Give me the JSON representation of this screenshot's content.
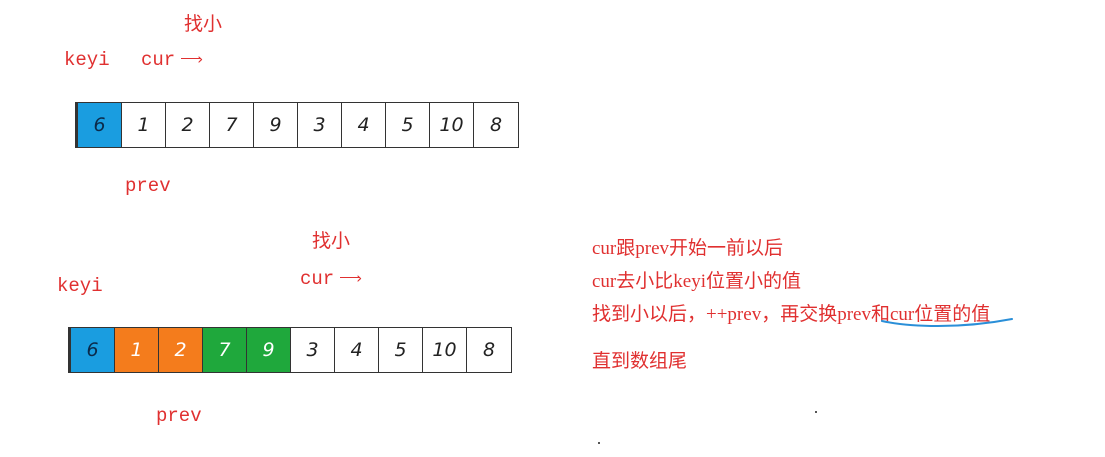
{
  "diagram1": {
    "find_small": "找小",
    "keyi": "keyi",
    "cur": "cur",
    "prev": "prev",
    "cells": [
      {
        "value": "6",
        "color": "blue"
      },
      {
        "value": "1",
        "color": "none"
      },
      {
        "value": "2",
        "color": "none"
      },
      {
        "value": "7",
        "color": "none"
      },
      {
        "value": "9",
        "color": "none"
      },
      {
        "value": "3",
        "color": "none"
      },
      {
        "value": "4",
        "color": "none"
      },
      {
        "value": "5",
        "color": "none"
      },
      {
        "value": "10",
        "color": "none"
      },
      {
        "value": "8",
        "color": "none"
      }
    ]
  },
  "diagram2": {
    "find_small": "找小",
    "keyi": "keyi",
    "cur": "cur",
    "prev": "prev",
    "cells": [
      {
        "value": "6",
        "color": "blue"
      },
      {
        "value": "1",
        "color": "orange"
      },
      {
        "value": "2",
        "color": "orange"
      },
      {
        "value": "7",
        "color": "green"
      },
      {
        "value": "9",
        "color": "green"
      },
      {
        "value": "3",
        "color": "none"
      },
      {
        "value": "4",
        "color": "none"
      },
      {
        "value": "5",
        "color": "none"
      },
      {
        "value": "10",
        "color": "none"
      },
      {
        "value": "8",
        "color": "none"
      }
    ]
  },
  "explanation": {
    "line1": "cur跟prev开始一前以后",
    "line2": "cur去小比keyi位置小的值",
    "line3": "找到小以后，++prev，再交换prev和cur位置的值",
    "line4": "直到数组尾"
  },
  "colors": {
    "label_red": "#e03030",
    "blue": "#1a9de0",
    "orange": "#f47c1c",
    "green": "#1fa83c",
    "underline_blue": "#2a8fd8"
  }
}
